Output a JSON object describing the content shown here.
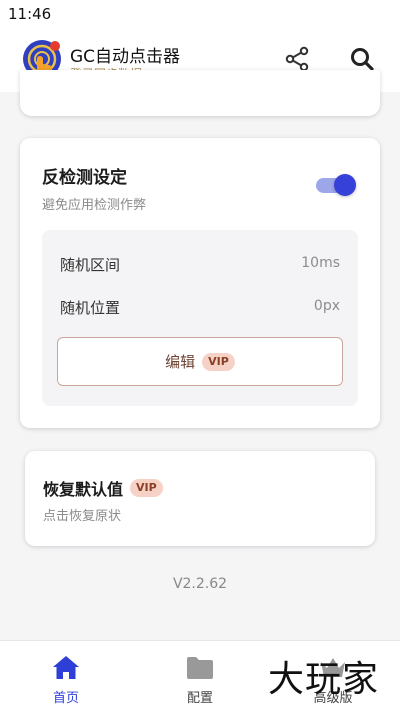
{
  "status_bar": {
    "time": "11:46"
  },
  "app_bar": {
    "title": "GC自动点击器",
    "subtitle": "登录同步数据",
    "logo_icon": "tap-target-icon",
    "share_icon": "share-icon",
    "search_icon": "search-icon"
  },
  "anti_detect": {
    "title": "反检测设定",
    "subtitle": "避免应用检测作弊",
    "toggle_on": true,
    "rows": [
      {
        "label": "随机区间",
        "value": "10ms"
      },
      {
        "label": "随机位置",
        "value": "0px"
      }
    ],
    "edit_label": "编辑",
    "vip_label": "VIP"
  },
  "reset": {
    "title": "恢复默认值",
    "vip_label": "VIP",
    "subtitle": "点击恢复原状"
  },
  "version": "V2.2.62",
  "bottom_nav": [
    {
      "label": "首页",
      "icon": "home-icon",
      "active": true
    },
    {
      "label": "配置",
      "icon": "folder-icon",
      "active": false
    },
    {
      "label": "高级版",
      "icon": "crown-icon",
      "active": false
    }
  ],
  "watermark": "大玩家",
  "colors": {
    "accent": "#3541d9",
    "toggle_track": "#9ea6ea",
    "vip_bg": "#f6d2c6",
    "vip_text": "#8a3f27",
    "subtitle_gold": "#a88d55"
  }
}
